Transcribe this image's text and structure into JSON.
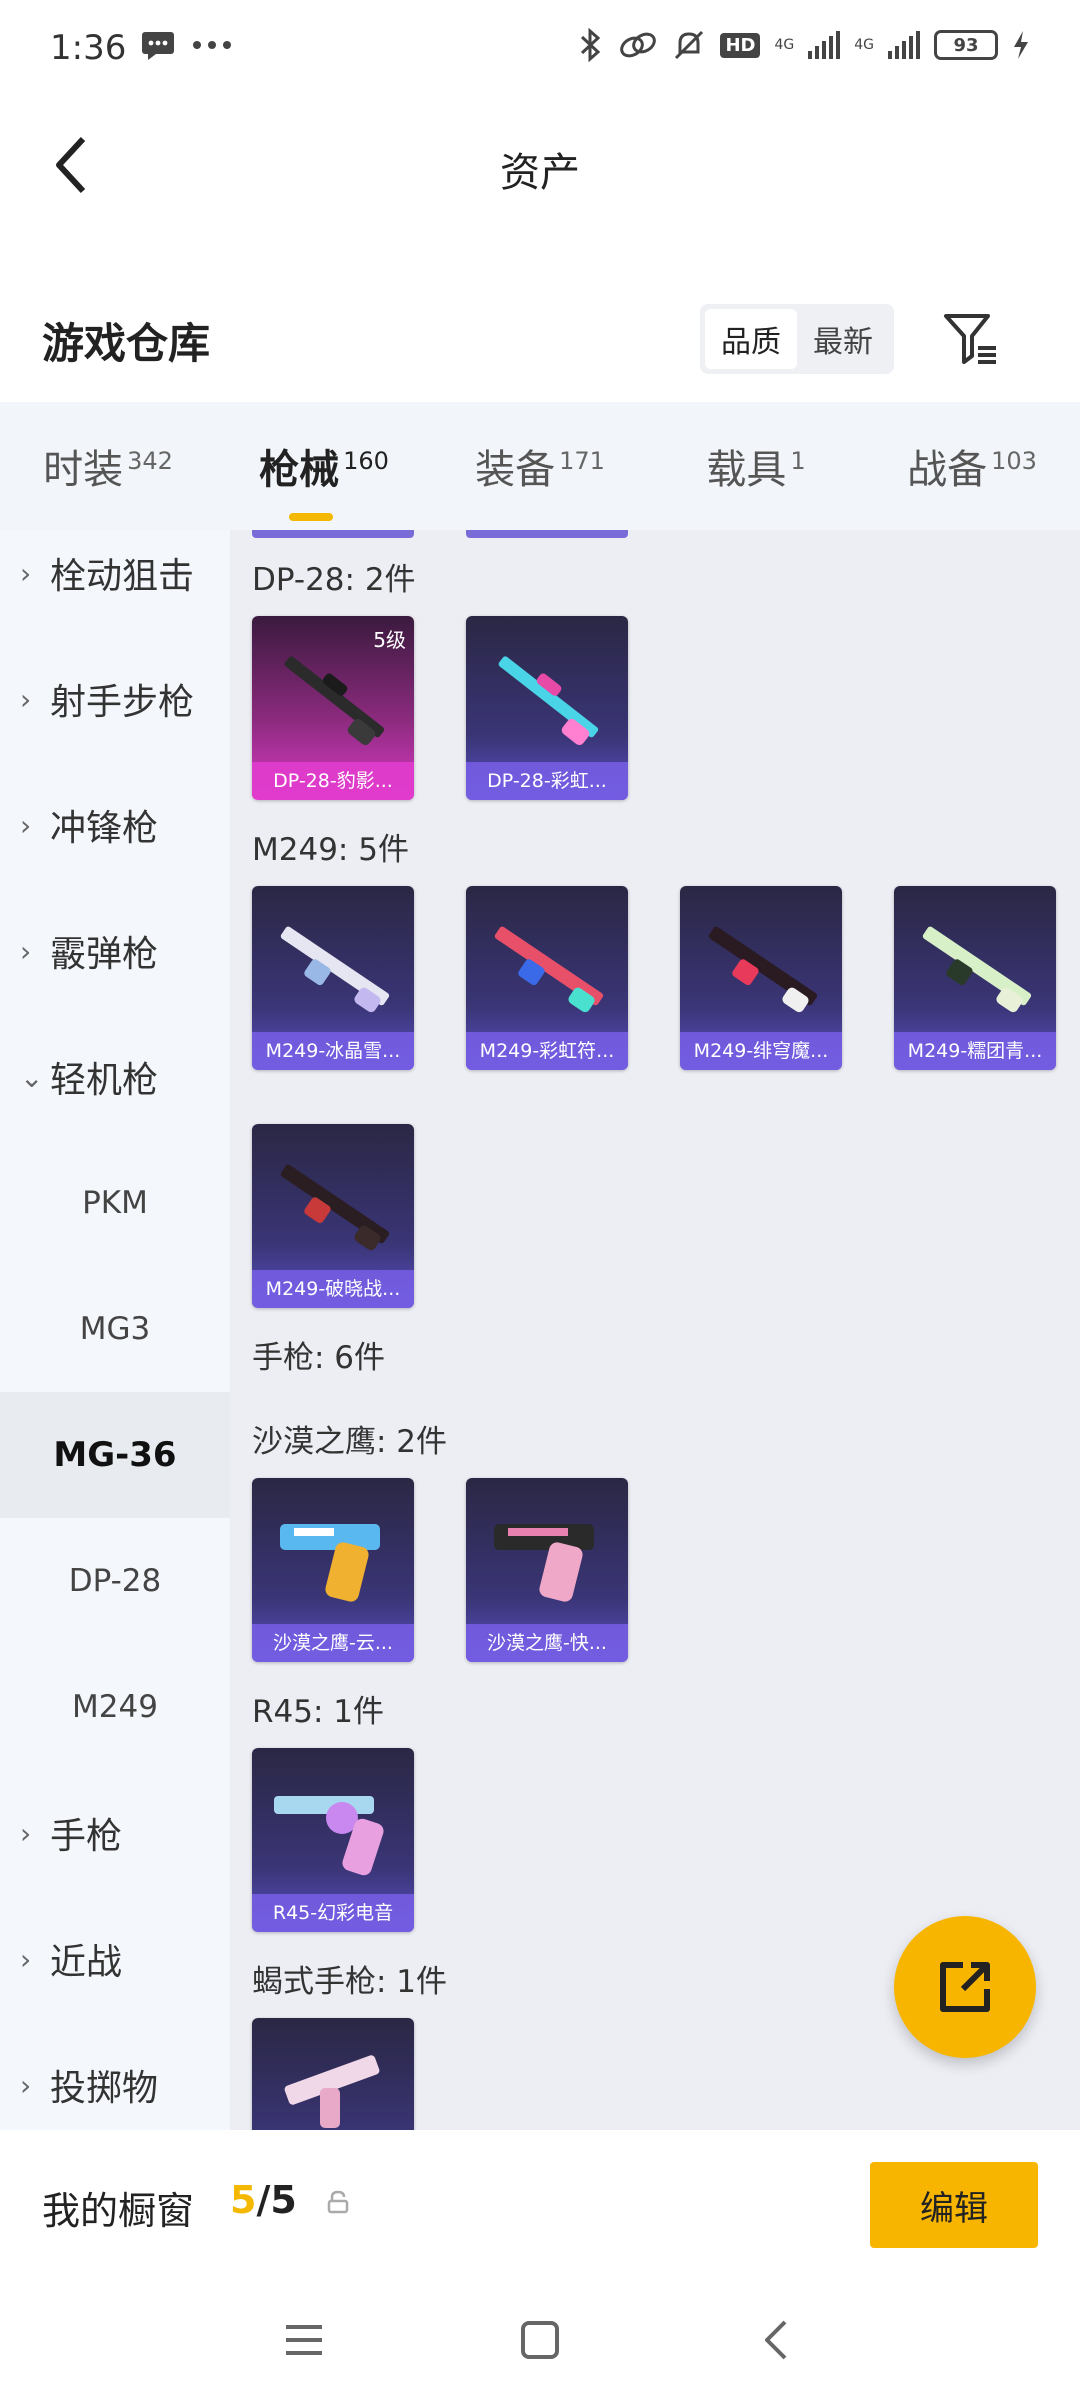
{
  "status_bar": {
    "time": "1:36",
    "battery": "93",
    "network_1": "4G",
    "network_2": "4G",
    "hd": "HD"
  },
  "header": {
    "title": "资产"
  },
  "warehouse": {
    "title": "游戏仓库",
    "sort_options": [
      "品质",
      "最新"
    ],
    "sort_selected": "品质"
  },
  "category_tabs": [
    {
      "label": "时装",
      "count": "342"
    },
    {
      "label": "枪械",
      "count": "160",
      "active": true
    },
    {
      "label": "装备",
      "count": "171"
    },
    {
      "label": "载具",
      "count": "1"
    },
    {
      "label": "战备",
      "count": "103"
    }
  ],
  "sidebar": {
    "items": [
      {
        "label": "栓动狙击",
        "chevron": "›"
      },
      {
        "label": "射手步枪",
        "chevron": "›"
      },
      {
        "label": "冲锋枪",
        "chevron": "›"
      },
      {
        "label": "霰弹枪",
        "chevron": "›"
      },
      {
        "label": "轻机枪",
        "chevron": "⌄"
      },
      {
        "label": "PKM"
      },
      {
        "label": "MG3"
      },
      {
        "label": "MG-36",
        "selected": true
      },
      {
        "label": "DP-28"
      },
      {
        "label": "M249"
      },
      {
        "label": "手枪",
        "chevron": "›"
      },
      {
        "label": "近战",
        "chevron": "›"
      },
      {
        "label": "投掷物",
        "chevron": "›"
      }
    ]
  },
  "content": {
    "groups": [
      {
        "label": "DP-28: 2件",
        "items": [
          {
            "name": "DP-28-豹影...",
            "level": "5级",
            "rare": true
          },
          {
            "name": "DP-28-彩虹..."
          }
        ]
      },
      {
        "label": "M249: 5件",
        "items": [
          {
            "name": "M249-冰晶雪..."
          },
          {
            "name": "M249-彩虹符..."
          },
          {
            "name": "M249-绯穹魔..."
          },
          {
            "name": "M249-糯团青..."
          },
          {
            "name": "M249-破晓战..."
          }
        ]
      },
      {
        "label": "手枪: 6件",
        "items": []
      },
      {
        "label": "沙漠之鹰: 2件",
        "items": [
          {
            "name": "沙漠之鹰-云..."
          },
          {
            "name": "沙漠之鹰-快..."
          }
        ]
      },
      {
        "label": "R45: 1件",
        "items": [
          {
            "name": "R45-幻彩电音"
          }
        ]
      },
      {
        "label": "蝎式手枪: 1件",
        "items": []
      }
    ]
  },
  "bottom_bar": {
    "showcase_label": "我的橱窗",
    "showcase_current": "5",
    "showcase_sep": "/",
    "showcase_total": "5",
    "edit_label": "编辑"
  },
  "colors": {
    "accent": "#f7b500",
    "card_dark": "#2a2744",
    "card_purple": "#5a4fc4",
    "card_rare": "#d93ac6",
    "sidebar_bg": "#f4f8fc",
    "content_bg": "#eceef4"
  }
}
